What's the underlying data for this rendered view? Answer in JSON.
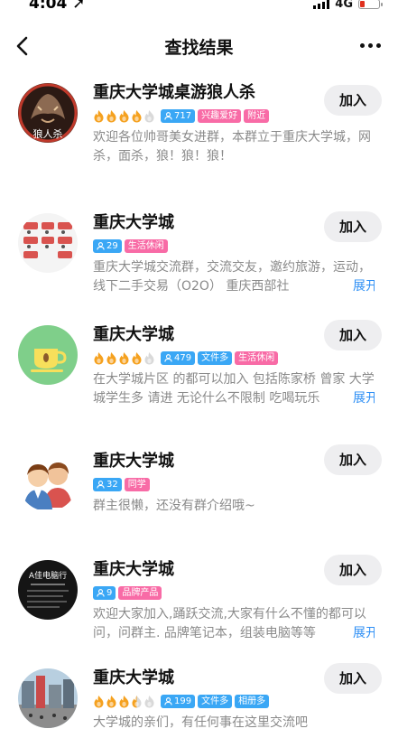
{
  "status_bar": {
    "time": "4:04 ➚",
    "network": "4G"
  },
  "nav": {
    "title": "查找结果"
  },
  "join_label": "加入",
  "expand_label": "展开",
  "items": [
    {
      "name": "重庆大学城桌游狼人杀",
      "flames": 4,
      "members": "717",
      "tags": [
        "兴趣爱好",
        "附近"
      ],
      "desc": "欢迎各位帅哥美女进群，本群立于重庆大学城，网杀，面杀，狼！狼！狼！",
      "avatar_icon": "werewolf-avatar-icon",
      "avatar_text": "狼人杀"
    },
    {
      "name": "重庆大学城",
      "flames": 0,
      "members": "29",
      "tags": [
        "生活休闲"
      ],
      "desc": "重庆大学城交流群，交流交友，邀约旅游，运动，线下二手交易（O2O） 重庆西部社",
      "avatar_icon": "fitness-avatar-icon"
    },
    {
      "name": "重庆大学城",
      "flames": 4,
      "members": "479",
      "tags": [
        "文件多",
        "生活休闲"
      ],
      "desc": "在大学城片区 的都可以加入 包括陈家桥 曾家 大学城学生多 请进 无论什么不限制 吃喝玩乐",
      "avatar_icon": "coffee-cup-avatar-icon"
    },
    {
      "name": "重庆大学城",
      "flames": 0,
      "members": "32",
      "tags": [
        "同学"
      ],
      "desc": "群主很懒，还没有群介绍哦~",
      "avatar_icon": "two-people-avatar-icon"
    },
    {
      "name": "重庆大学城",
      "flames": 0,
      "members": "9",
      "tags": [
        "品牌产品"
      ],
      "desc": "欢迎大家加入,踊跃交流,大家有什么不懂的都可以问，问群主. 品牌笔记本，组装电脑等等",
      "avatar_icon": "computer-store-avatar-icon",
      "avatar_text": "A佳电脑行"
    },
    {
      "name": "重庆大学城",
      "flames": 3.5,
      "members": "199",
      "tags": [
        "文件多",
        "相册多"
      ],
      "desc": "大学城的亲们，有任何事在这里交流吧",
      "avatar_icon": "city-street-avatar-icon"
    }
  ],
  "colors": {
    "accent_blue": "#3aa7f5",
    "accent_pink": "#f86ba6",
    "flame_on": "#f5a11f",
    "flame_off": "#d9d9d9",
    "link": "#2e8ff5"
  }
}
